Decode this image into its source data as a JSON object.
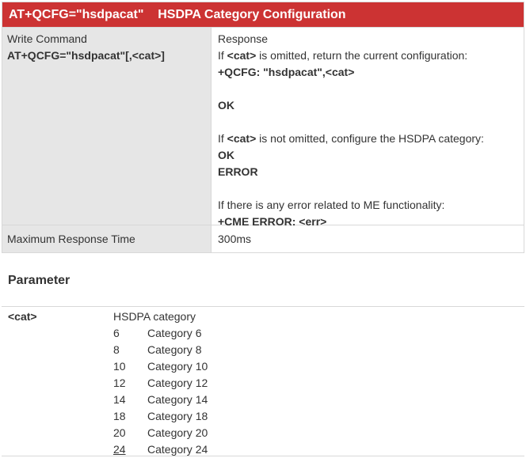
{
  "command": {
    "title": "AT+QCFG=\"hsdpacat\"    HSDPA Category Configuration",
    "write_label": "Write Command",
    "write_syntax": "AT+QCFG=\"hsdpacat\"[,<cat>]",
    "response_label": "Response",
    "resp_omit_pre": "If ",
    "resp_omit_param": "<cat>",
    "resp_omit_post": " is omitted, return the current configuration:",
    "resp_qcfg": "+QCFG: \"hsdpacat\",<cat>",
    "resp_ok1": "OK",
    "resp_set_pre": "If ",
    "resp_set_param": "<cat>",
    "resp_set_post": " is not omitted, configure the HSDPA category:",
    "resp_ok2": "OK",
    "resp_error": "ERROR",
    "resp_me_note": "If there is any error related to ME functionality:",
    "resp_cme": "+CME ERROR: <err>",
    "max_time_label": "Maximum Response Time",
    "max_time_value": "300ms"
  },
  "parameter": {
    "heading": "Parameter",
    "name": "<cat>",
    "description": "HSDPA category",
    "values": [
      {
        "code": "6",
        "label": "Category 6"
      },
      {
        "code": "8",
        "label": "Category 8"
      },
      {
        "code": "10",
        "label": "Category 10"
      },
      {
        "code": "12",
        "label": "Category 12"
      },
      {
        "code": "14",
        "label": "Category 14"
      },
      {
        "code": "18",
        "label": "Category 18"
      },
      {
        "code": "20",
        "label": "Category 20"
      },
      {
        "code": "24",
        "label": "Category 24"
      }
    ],
    "default_code": "24"
  },
  "colors": {
    "title_bar": "#cc3333",
    "left_cell": "#e6e6e6",
    "border": "#d8d8d8",
    "text": "#333333"
  }
}
